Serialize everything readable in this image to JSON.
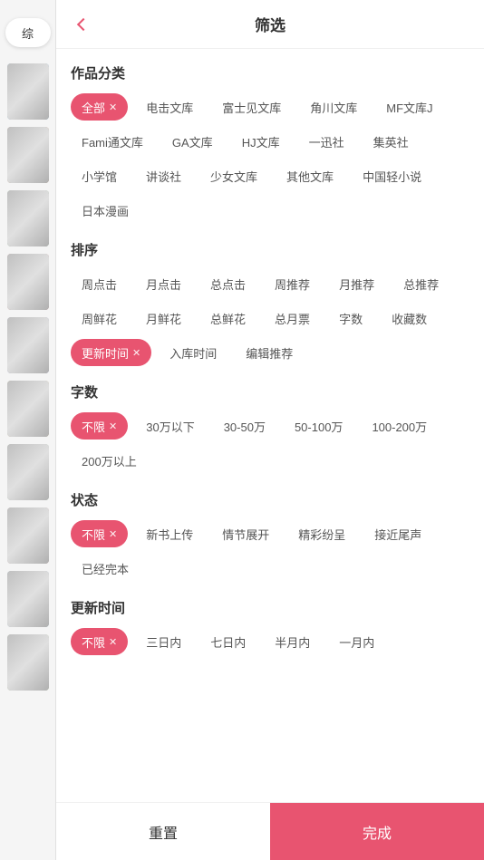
{
  "header": {
    "title": "筛选",
    "back_label": "back"
  },
  "sidebar": {
    "tabs": [
      {
        "label": "综",
        "active": true
      }
    ],
    "covers": [
      1,
      2,
      3,
      4,
      5,
      6,
      7,
      8,
      9,
      10
    ]
  },
  "sections": [
    {
      "id": "category",
      "title": "作品分类",
      "tags": [
        {
          "label": "全部",
          "active": true,
          "closeable": true
        },
        {
          "label": "电击文库",
          "active": false
        },
        {
          "label": "富士见文库",
          "active": false
        },
        {
          "label": "角川文库",
          "active": false
        },
        {
          "label": "MF文库J",
          "active": false
        },
        {
          "label": "Fami通文库",
          "active": false
        },
        {
          "label": "GA文库",
          "active": false
        },
        {
          "label": "HJ文库",
          "active": false
        },
        {
          "label": "一迅社",
          "active": false
        },
        {
          "label": "集英社",
          "active": false
        },
        {
          "label": "小学馆",
          "active": false
        },
        {
          "label": "讲谈社",
          "active": false
        },
        {
          "label": "少女文库",
          "active": false
        },
        {
          "label": "其他文库",
          "active": false
        },
        {
          "label": "中国轻小说",
          "active": false
        },
        {
          "label": "日本漫画",
          "active": false
        }
      ]
    },
    {
      "id": "sort",
      "title": "排序",
      "tags": [
        {
          "label": "周点击",
          "active": false
        },
        {
          "label": "月点击",
          "active": false
        },
        {
          "label": "总点击",
          "active": false
        },
        {
          "label": "周推荐",
          "active": false
        },
        {
          "label": "月推荐",
          "active": false
        },
        {
          "label": "总推荐",
          "active": false
        },
        {
          "label": "周鲜花",
          "active": false
        },
        {
          "label": "月鲜花",
          "active": false
        },
        {
          "label": "总鲜花",
          "active": false
        },
        {
          "label": "总月票",
          "active": false
        },
        {
          "label": "字数",
          "active": false
        },
        {
          "label": "收藏数",
          "active": false
        },
        {
          "label": "更新时间",
          "active": true,
          "closeable": true
        },
        {
          "label": "入库时间",
          "active": false
        },
        {
          "label": "编辑推荐",
          "active": false
        }
      ]
    },
    {
      "id": "wordcount",
      "title": "字数",
      "tags": [
        {
          "label": "不限",
          "active": true,
          "closeable": true
        },
        {
          "label": "30万以下",
          "active": false
        },
        {
          "label": "30-50万",
          "active": false
        },
        {
          "label": "50-100万",
          "active": false
        },
        {
          "label": "100-200万",
          "active": false
        },
        {
          "label": "200万以上",
          "active": false
        }
      ]
    },
    {
      "id": "status",
      "title": "状态",
      "tags": [
        {
          "label": "不限",
          "active": true,
          "closeable": true
        },
        {
          "label": "新书上传",
          "active": false
        },
        {
          "label": "情节展开",
          "active": false
        },
        {
          "label": "精彩纷呈",
          "active": false
        },
        {
          "label": "接近尾声",
          "active": false
        },
        {
          "label": "已经完本",
          "active": false
        }
      ]
    },
    {
      "id": "update-time",
      "title": "更新时间",
      "tags": [
        {
          "label": "不限",
          "active": true,
          "closeable": true
        },
        {
          "label": "三日内",
          "active": false
        },
        {
          "label": "七日内",
          "active": false
        },
        {
          "label": "半月内",
          "active": false
        },
        {
          "label": "一月内",
          "active": false
        }
      ]
    }
  ],
  "footer": {
    "reset_label": "重置",
    "confirm_label": "完成"
  }
}
